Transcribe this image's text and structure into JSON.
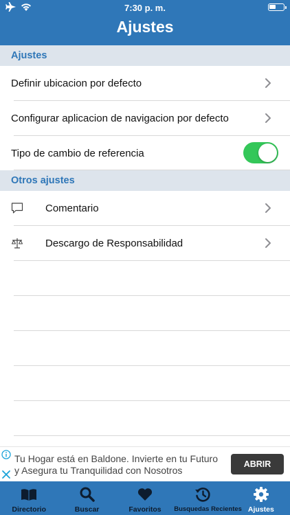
{
  "status_bar": {
    "time": "7:30 p. m."
  },
  "header": {
    "title": "Ajustes"
  },
  "section_ajustes": {
    "title": "Ajustes",
    "rows": [
      {
        "label": "Definir ubicacion por defecto"
      },
      {
        "label": "Configurar aplicacion de navigacion por defecto"
      },
      {
        "label": "Tipo de cambio de referencia",
        "toggle_on": true
      }
    ]
  },
  "section_otros": {
    "title": "Otros ajustes",
    "rows": [
      {
        "label": "Comentario",
        "icon": "comment-icon"
      },
      {
        "label": "Descargo de Responsabilidad",
        "icon": "scale-icon"
      }
    ]
  },
  "ad": {
    "text": "Tu Hogar está en Baldone. Invierte en tu Futuro y Asegura tu Tranquilidad con Nosotros",
    "button": "ABRIR"
  },
  "tabbar": {
    "tabs": [
      {
        "label": "Directorio",
        "icon": "book-icon"
      },
      {
        "label": "Buscar",
        "icon": "search-icon"
      },
      {
        "label": "Favoritos",
        "icon": "heart-icon"
      },
      {
        "label": "Busquedas Recientes",
        "icon": "history-icon"
      },
      {
        "label": "Ajustes",
        "icon": "gear-icon",
        "active": true
      }
    ]
  },
  "colors": {
    "accent": "#2f77b8",
    "toggle_on": "#34c759",
    "section_bg": "#dde4ec"
  }
}
